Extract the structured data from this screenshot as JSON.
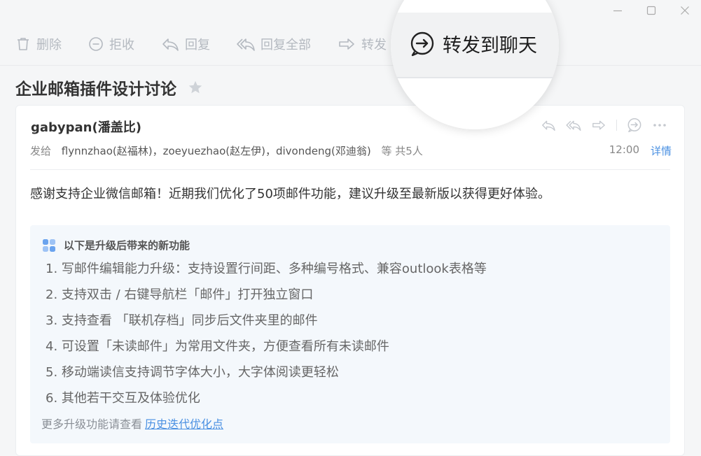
{
  "toolbar": {
    "delete_label": "删除",
    "reject_label": "拒收",
    "reply_label": "回复",
    "reply_all_label": "回复全部",
    "forward_label": "转发",
    "forward_to_chat_label": "转发到聊天"
  },
  "email": {
    "subject": "企业邮箱插件设计讨论",
    "sender": "gabypan(潘盖比)",
    "to_label": "发给",
    "recipients": [
      "flynnzhao(赵福林)",
      "zoeyuezhao(赵左伊)",
      "divondeng(邓迪翁)"
    ],
    "recipient_separator": "，",
    "recipient_more": "等 共5人",
    "time": "12:00",
    "detail_label": "详情",
    "body": "感谢支持企业微信邮箱！近期我们优化了50项邮件功能，建议升级至最新版以获得更好体验。"
  },
  "features": {
    "title": "以下是升级后带来的新功能",
    "items": [
      "1. 写邮件编辑能力升级：支持设置行间距、多种编号格式、兼容outlook表格等",
      "2. 支持双击 / 右键导航栏「邮件」打开独立窗口",
      "3. 支持查看 「联机存档」同步后文件夹里的邮件",
      "4. 可设置「未读邮件」为常用文件夹，方便查看所有未读邮件",
      "5. 移动端读信支持调节字体大小，大字体阅读更轻松",
      "6. 其他若干交互及体验优化"
    ],
    "more_text": "更多升级功能请查看",
    "more_link": "历史迭代优化点"
  },
  "colors": {
    "accent": "#4a90e2",
    "toolbar_icon": "#b4b9c0",
    "feature_icon": "#6aa3ee",
    "feature_bg": "#f4f8fc"
  },
  "icons": {
    "delete": "trash-icon",
    "reject": "minus-circle-icon",
    "reply": "reply-icon",
    "reply_all": "reply-all-icon",
    "forward": "forward-icon",
    "forward_to_chat": "chat-forward-icon",
    "star": "star-icon",
    "more": "more-dots-icon",
    "features": "grid-icon"
  }
}
